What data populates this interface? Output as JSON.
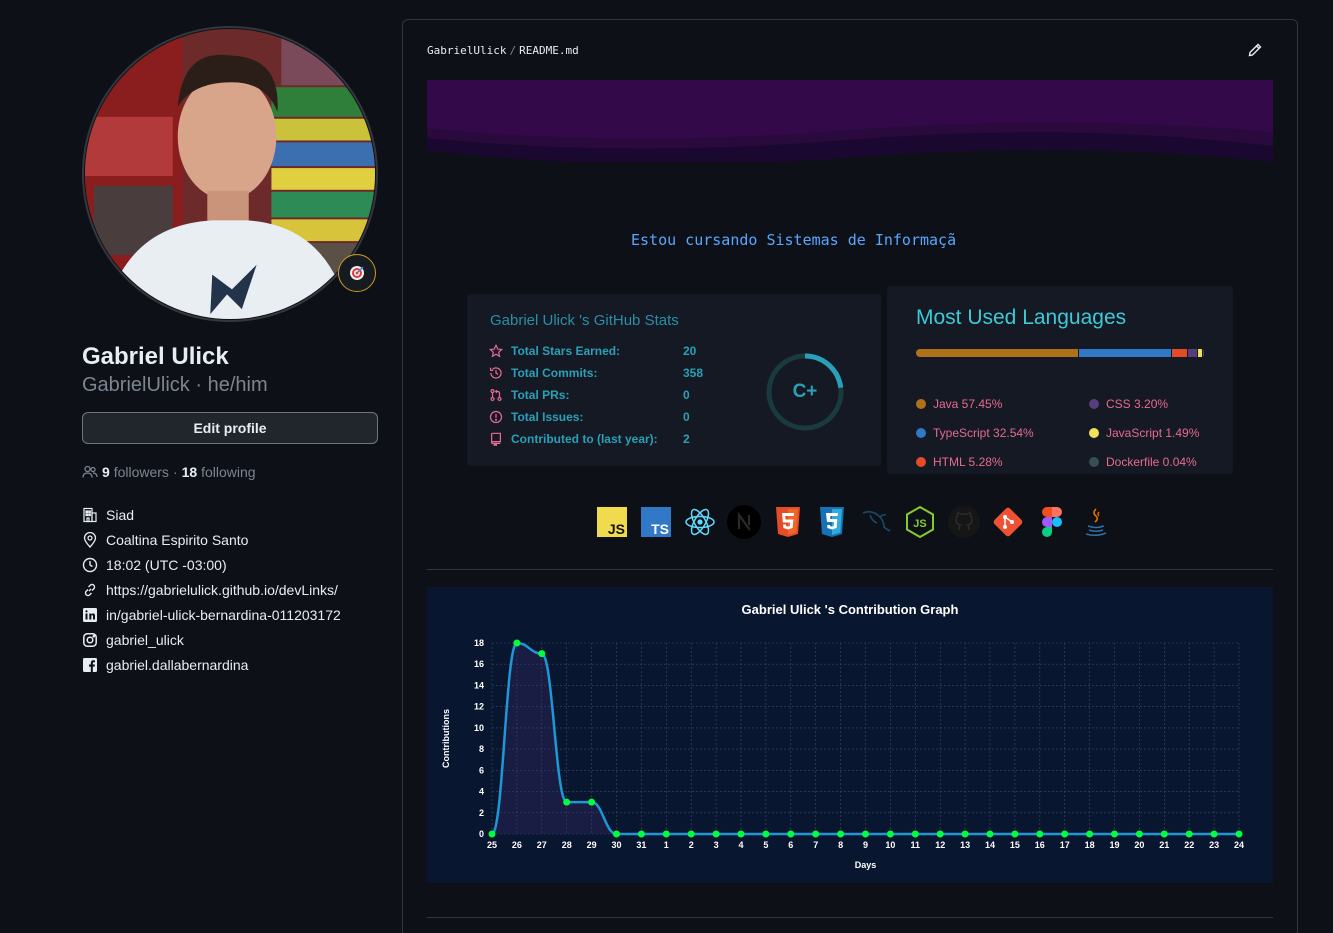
{
  "profile": {
    "name": "Gabriel Ulick",
    "login": "GabrielUlick",
    "pronouns": "he/him",
    "edit_label": "Edit profile",
    "followers_count": "9",
    "followers_label": "followers",
    "following_count": "18",
    "following_label": "following",
    "details": [
      {
        "icon": "organization-icon",
        "text": "Siad"
      },
      {
        "icon": "location-icon",
        "text": "Coaltina Espirito Santo"
      },
      {
        "icon": "clock-icon",
        "text": "18:02 (UTC -03:00)"
      },
      {
        "icon": "link-icon",
        "text": "https://gabrielulick.github.io/devLinks/"
      },
      {
        "icon": "linkedin-icon",
        "text": "in/gabriel-ulick-bernardina-011203172"
      },
      {
        "icon": "instagram-icon",
        "text": "gabriel_ulick"
      },
      {
        "icon": "facebook-icon",
        "text": "gabriel.dallabernardina"
      }
    ]
  },
  "readme": {
    "owner": "GabrielUlick",
    "file": "README.md",
    "typing_text": "Estou cursando Sistemas de Informaçã"
  },
  "stats": {
    "title": "Gabriel Ulick 's GitHub Stats",
    "rows": [
      {
        "icon": "star-icon",
        "label": "Total Stars Earned:",
        "value": "20"
      },
      {
        "icon": "history-icon",
        "label": "Total Commits:",
        "value": "358"
      },
      {
        "icon": "pull-request-icon",
        "label": "Total PRs:",
        "value": "0"
      },
      {
        "icon": "issue-icon",
        "label": "Total Issues:",
        "value": "0"
      },
      {
        "icon": "repo-icon",
        "label": "Contributed to (last year):",
        "value": "2"
      }
    ],
    "grade": "C+",
    "grade_progress": 0.23
  },
  "languages": {
    "title": "Most Used Languages",
    "items": [
      {
        "name": "Java 57.45%",
        "percent": 57.45,
        "color": "#b07219"
      },
      {
        "name": "TypeScript 32.54%",
        "percent": 32.54,
        "color": "#3178c6"
      },
      {
        "name": "HTML 5.28%",
        "percent": 5.28,
        "color": "#e34c26"
      },
      {
        "name": "CSS 3.20%",
        "percent": 3.2,
        "color": "#563d7c"
      },
      {
        "name": "JavaScript 1.49%",
        "percent": 1.49,
        "color": "#f1e05a"
      },
      {
        "name": "Dockerfile 0.04%",
        "percent": 0.04,
        "color": "#384d54"
      }
    ]
  },
  "techs": [
    "javascript-icon",
    "typescript-icon",
    "react-icon",
    "nextjs-icon",
    "html5-icon",
    "css3-icon",
    "mysql-icon",
    "nodejs-icon",
    "github-icon",
    "git-icon",
    "figma-icon",
    "java-icon"
  ],
  "colors": {
    "background": "#0d1117",
    "border": "#30363d",
    "accent": "#58a6ff",
    "graph_bg": "#091630",
    "graph_line": "#1f97d4",
    "graph_point": "#00ff3f"
  },
  "chart_data": {
    "type": "line",
    "title": "Gabriel Ulick 's Contribution Graph",
    "xlabel": "Days",
    "ylabel": "Contributions",
    "categories": [
      "25",
      "26",
      "27",
      "28",
      "29",
      "30",
      "31",
      "1",
      "2",
      "3",
      "4",
      "5",
      "6",
      "7",
      "8",
      "9",
      "10",
      "11",
      "12",
      "13",
      "14",
      "15",
      "16",
      "17",
      "18",
      "19",
      "20",
      "21",
      "22",
      "23",
      "24"
    ],
    "series": [
      {
        "values": [
          0,
          18,
          17,
          3,
          3,
          0,
          0,
          0,
          0,
          0,
          0,
          0,
          0,
          0,
          0,
          0,
          0,
          0,
          0,
          0,
          0,
          0,
          0,
          0,
          0,
          0,
          0,
          0,
          0,
          0,
          0
        ]
      }
    ],
    "yticks": [
      0,
      2,
      4,
      6,
      8,
      10,
      12,
      14,
      16,
      18
    ],
    "ylim": [
      0,
      18
    ],
    "grid": true
  }
}
